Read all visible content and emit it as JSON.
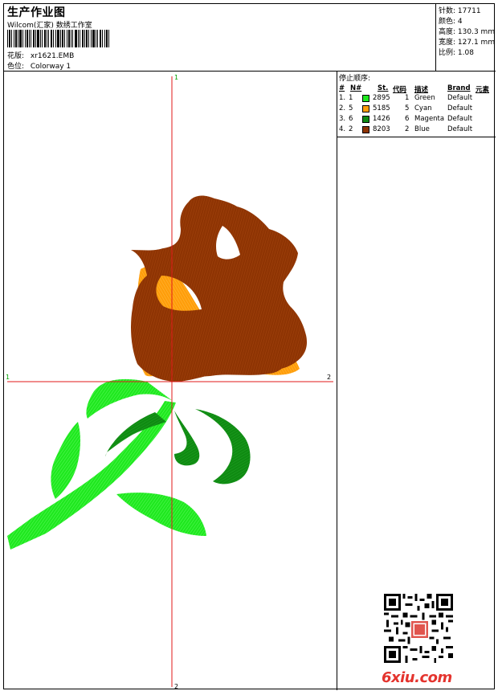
{
  "header": {
    "title": "生产作业图",
    "company": "Wilcom(汇家) 数绣工作室",
    "design_label": "花版:",
    "design_value": "xr1621.EMB",
    "colorway_label": "色位:",
    "colorway_value": "Colorway 1"
  },
  "stats": {
    "stitches_label": "针数:",
    "stitches_value": "17711",
    "colors_label": "颜色:",
    "colors_value": "4",
    "height_label": "高度:",
    "height_value": "130.3 mm",
    "width_label": "宽度:",
    "width_value": "127.1 mm",
    "ratio_label": "比例:",
    "ratio_value": "1.08"
  },
  "canvas": {
    "guide_top": "1",
    "guide_bottom": "2",
    "guide_left": "1",
    "guide_right": "2"
  },
  "stop_sequence": {
    "title": "停止顺序:",
    "columns": [
      "#",
      "N#",
      "St.",
      "代码",
      "描述",
      "Brand",
      "元素"
    ],
    "rows": [
      {
        "index": "1.",
        "needle": "1",
        "color": "#1fe81f",
        "code": "2895",
        "st": "1",
        "desc": "Green",
        "brand": "Default"
      },
      {
        "index": "2.",
        "needle": "5",
        "color": "#ff9d0a",
        "code": "5185",
        "st": "5",
        "desc": "Cyan",
        "brand": "Default"
      },
      {
        "index": "3.",
        "needle": "6",
        "color": "#0f8a12",
        "code": "1426",
        "st": "6",
        "desc": "Magenta",
        "brand": "Default"
      },
      {
        "index": "4.",
        "needle": "2",
        "color": "#8e3403",
        "code": "8203",
        "st": "2",
        "desc": "Blue",
        "brand": "Default"
      }
    ]
  },
  "watermark": "6xiu.com",
  "colors": {
    "leaf_green": "#1fe81f",
    "petal_orange": "#ff9d0a",
    "leaf_dark": "#0f8a12",
    "rose_brown": "#8e3403",
    "guide_red": "#e01a1a",
    "guide_label_green": "#00a000"
  }
}
